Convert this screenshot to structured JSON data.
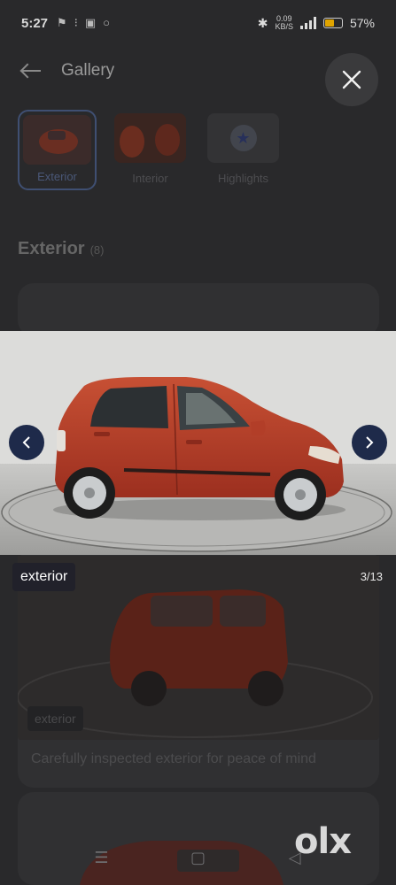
{
  "status_bar": {
    "time": "5:27",
    "net_speed_top": "0.09",
    "net_speed_bottom": "KB/S",
    "network_type": "4G",
    "battery_percent": "57%",
    "battery_level": 0.57,
    "icons": [
      "notification-icon",
      "whatsapp-icon",
      "photo-icon",
      "circle-icon",
      "bluetooth-icon",
      "signal-icon",
      "battery-icon"
    ]
  },
  "header": {
    "title": "Gallery",
    "back_icon": "back-arrow-icon",
    "close_icon": "close-icon"
  },
  "categories": [
    {
      "label": "Exterior",
      "active": true
    },
    {
      "label": "Interior",
      "active": false
    },
    {
      "label": "Highlights",
      "active": false
    }
  ],
  "section": {
    "title": "Exterior",
    "count": "(8)"
  },
  "viewer": {
    "caption": "exterior",
    "counter": "3/13",
    "prev_icon": "chevron-left-icon",
    "next_icon": "chevron-right-icon",
    "car_color": "#b8402a"
  },
  "background_card": {
    "tag": "exterior",
    "caption": "Carefully inspected exterior for peace of mind"
  },
  "bottom_nav": {
    "menu_icon": "menu-icon",
    "home_icon": "home-icon",
    "back_icon": "back-triangle-icon"
  },
  "brand": {
    "logo_text": "olx"
  },
  "colors": {
    "accent": "#1e2a4a",
    "overlay_background": "#29292b"
  }
}
